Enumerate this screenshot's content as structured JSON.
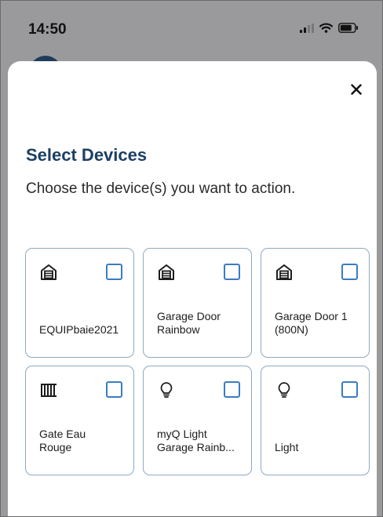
{
  "status_bar": {
    "time": "14:50",
    "icons": [
      "signal-icon",
      "wifi-icon",
      "battery-icon"
    ]
  },
  "dialog": {
    "close_icon": "close-icon",
    "title": "Select Devices",
    "subtitle": "Choose the device(s) you want to action."
  },
  "devices": [
    {
      "name": "EQUIPbaie2021",
      "icon": "garage-door-icon",
      "checked": false
    },
    {
      "name": "Garage Door\nRainbow",
      "icon": "garage-door-icon",
      "checked": false
    },
    {
      "name": "Garage Door 1\n(800N)",
      "icon": "garage-door-icon",
      "checked": false
    },
    {
      "name": "Gate Eau\nRouge",
      "icon": "gate-icon",
      "checked": false
    },
    {
      "name": "myQ Light\nGarage Rainb...",
      "icon": "light-bulb-icon",
      "checked": false
    },
    {
      "name": "Light",
      "icon": "light-bulb-icon",
      "checked": false
    }
  ],
  "colors": {
    "accent": "#1b3f63",
    "checkbox": "#3a7cc2",
    "card_border": "#8fa9c4"
  }
}
